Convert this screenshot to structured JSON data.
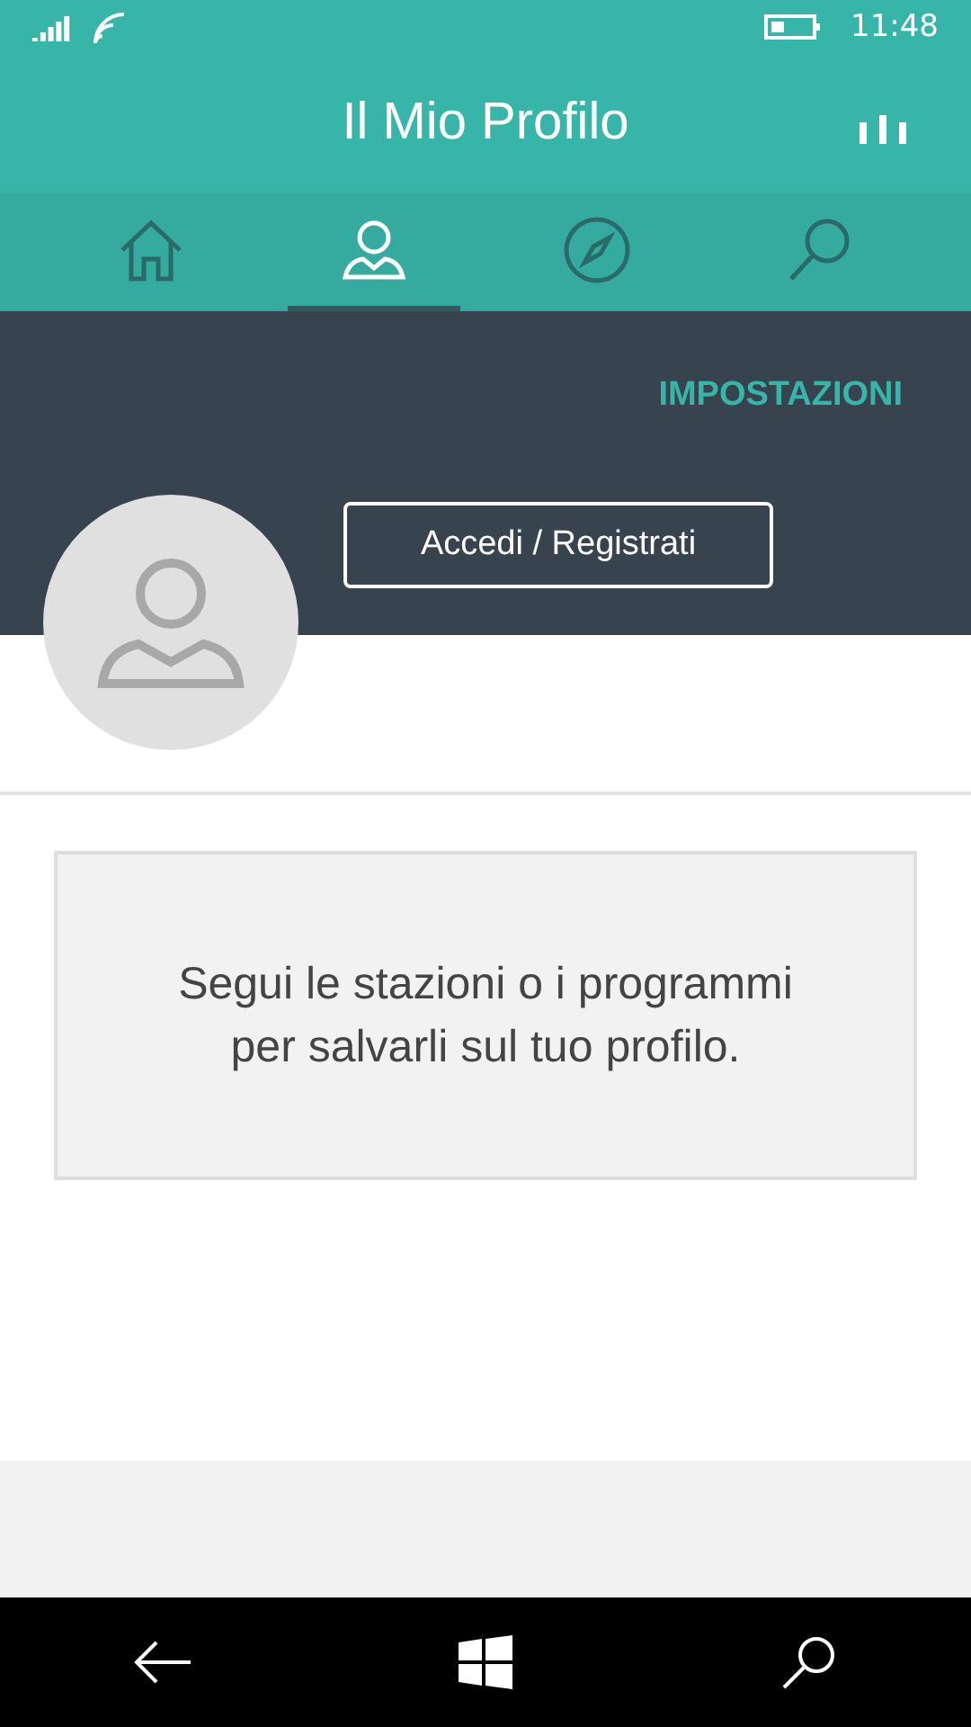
{
  "status_bar": {
    "time": "11:48"
  },
  "header": {
    "title": "Il Mio Profilo"
  },
  "tabs": [
    {
      "kind": "home",
      "selected": false
    },
    {
      "kind": "profile",
      "selected": true
    },
    {
      "kind": "explore",
      "selected": false
    },
    {
      "kind": "search",
      "selected": false
    }
  ],
  "profile": {
    "settings_link": "IMPOSTAZIONI",
    "login_button": "Accedi / Registrati"
  },
  "message": "Segui le stazioni o i programmi per salvarli sul tuo profilo."
}
